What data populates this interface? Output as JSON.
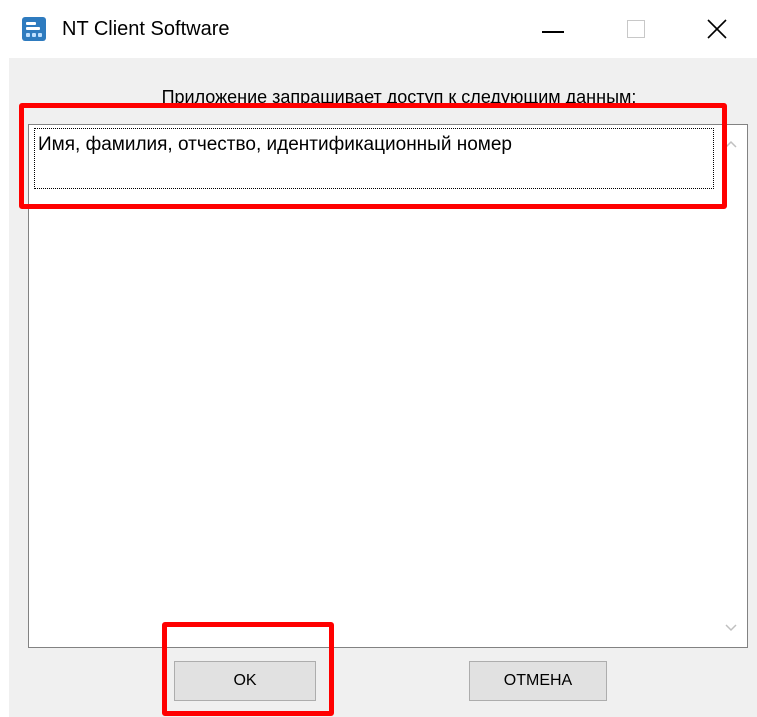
{
  "window": {
    "title": "NT Client Software",
    "icon": "app-icon"
  },
  "header": {
    "label": "Приложение запрашивает доступ к следующим данным:"
  },
  "list": {
    "items": [
      "Имя, фамилия, отчество, идентификационный номер"
    ]
  },
  "buttons": {
    "ok_label": "OK",
    "cancel_label": "ОТМЕНА"
  },
  "colors": {
    "highlight": "#ff0000",
    "client_background": "#f0f0f0",
    "button_background": "#e1e1e1",
    "app_icon": "#2e7bbf"
  }
}
